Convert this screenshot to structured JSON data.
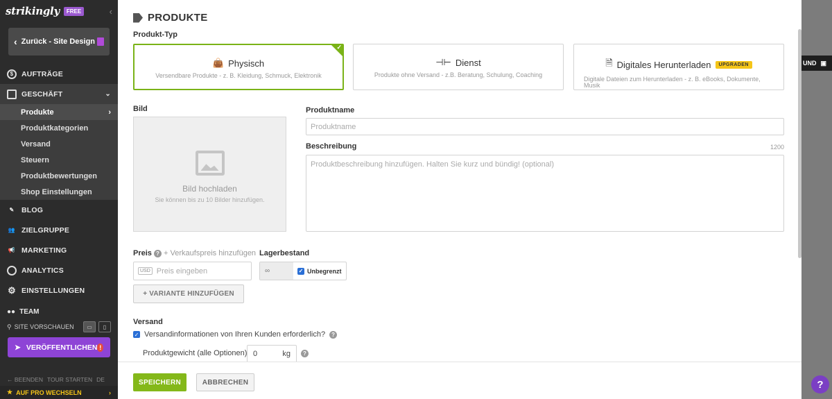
{
  "sidebar": {
    "logo": "strikingly",
    "free_badge": "FREE",
    "back_label": "Zurück - Site Design",
    "nav": {
      "orders": "AUFTRÄGE",
      "business": "GESCHÄFT",
      "blog": "BLOG",
      "audience": "ZIELGRUPPE",
      "marketing": "MARKETING",
      "analytics": "ANALYTICS",
      "settings": "EINSTELLUNGEN",
      "team": "TEAM"
    },
    "sub_items": [
      "Produkte",
      "Produktkategorien",
      "Versand",
      "Steuern",
      "Produktbewertungen",
      "Shop Einstellungen"
    ],
    "preview_label": "SITE VORSCHAUEN",
    "publish_label": "VERÖFFENTLICHEN",
    "footer_links": [
      "BEENDEN",
      "TOUR STARTEN",
      "DE"
    ],
    "pro_label": "AUF PRO WECHSELN"
  },
  "modal": {
    "title": "PRODUKTE",
    "product_type_label": "Produkt-Typ",
    "types": [
      {
        "title": "Physisch",
        "subtitle": "Versendbare Produkte - z. B. Kleidung, Schmuck, Elektronik",
        "icon": "bag-icon"
      },
      {
        "title": "Dienst",
        "subtitle": "Produkte ohne Versand - z.B. Beratung, Schulung, Coaching",
        "icon": "dumbbell-icon"
      },
      {
        "title": "Digitales Herunterladen",
        "subtitle": "Digitale Dateien zum Herunterladen - z. B. eBooks, Dokumente, Musik",
        "icon": "file-icon",
        "badge": "UPGRADEN"
      }
    ],
    "image_label": "Bild",
    "upload_title": "Bild hochladen",
    "upload_hint": "Sie können bis zu 10 Bilder hinzufügen.",
    "name_label": "Produktname",
    "name_placeholder": "Produktname",
    "desc_label": "Beschreibung",
    "desc_count": "1200",
    "desc_placeholder": "Produktbeschreibung hinzufügen. Halten Sie kurz und bündig! (optional)",
    "price_label": "Preis",
    "sale_price_link": "+ Verkaufspreis hinzufügen",
    "currency": "USD",
    "price_placeholder": "Preis eingeben",
    "stock_label": "Lagerbestand",
    "stock_value": "∞",
    "unlimited_label": "Unbegrenzt",
    "add_variant": "+ VARIANTE HINZUFÜGEN",
    "shipping_label": "Versand",
    "shipping_question": "Versandinformationen von Ihren Kunden erforderlich?",
    "weight_label": "Produktgewicht (alle Optionen)",
    "weight_value": "0",
    "weight_unit": "kg",
    "save": "SPEICHERN",
    "cancel": "ABBRECHEN"
  },
  "background": {
    "pill_text": "UND"
  },
  "colors": {
    "accent_green": "#7ab317",
    "publish_purple": "#8e44d6",
    "upgrade_yellow": "#f5c518"
  }
}
